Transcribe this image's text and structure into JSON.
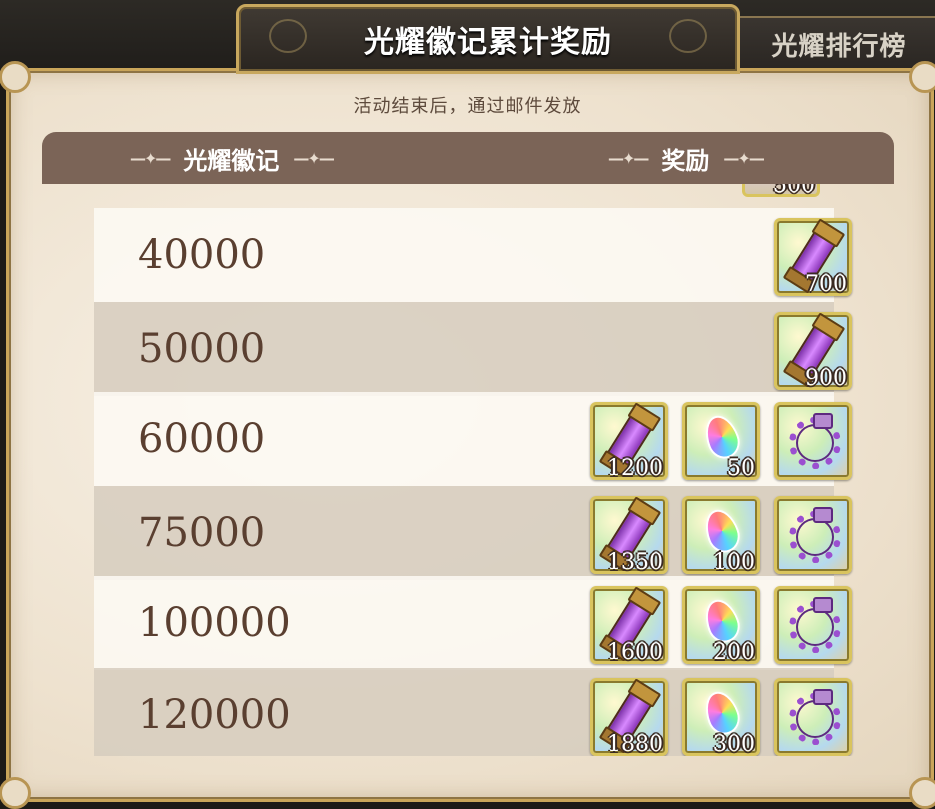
{
  "tabs": {
    "active_label": "光耀徽记累计奖励",
    "inactive_label": "光耀排行榜"
  },
  "notice": "活动结束后，通过邮件发放",
  "header": {
    "left": "光耀徽记",
    "right": "奖励",
    "decor": "—✦—"
  },
  "partial_row_qty": "500",
  "rows": [
    {
      "score": "40000",
      "rewards": [
        {
          "icon": "vial-icon",
          "qty": "700"
        }
      ]
    },
    {
      "score": "50000",
      "rewards": [
        {
          "icon": "vial-icon",
          "qty": "900"
        }
      ]
    },
    {
      "score": "60000",
      "rewards": [
        {
          "icon": "vial-icon",
          "qty": "1200"
        },
        {
          "icon": "rainbow-drop-icon",
          "qty": "50"
        },
        {
          "icon": "amethyst-ring-icon",
          "qty": ""
        }
      ]
    },
    {
      "score": "75000",
      "rewards": [
        {
          "icon": "vial-icon",
          "qty": "1350"
        },
        {
          "icon": "rainbow-drop-icon",
          "qty": "100"
        },
        {
          "icon": "amethyst-ring-icon",
          "qty": ""
        }
      ]
    },
    {
      "score": "100000",
      "rewards": [
        {
          "icon": "vial-icon",
          "qty": "1600"
        },
        {
          "icon": "rainbow-drop-icon",
          "qty": "200"
        },
        {
          "icon": "amethyst-ring-icon",
          "qty": ""
        }
      ]
    },
    {
      "score": "120000",
      "rewards": [
        {
          "icon": "vial-icon",
          "qty": "1880"
        },
        {
          "icon": "rainbow-drop-icon",
          "qty": "300"
        },
        {
          "icon": "amethyst-ring-icon",
          "qty": ""
        }
      ]
    }
  ]
}
